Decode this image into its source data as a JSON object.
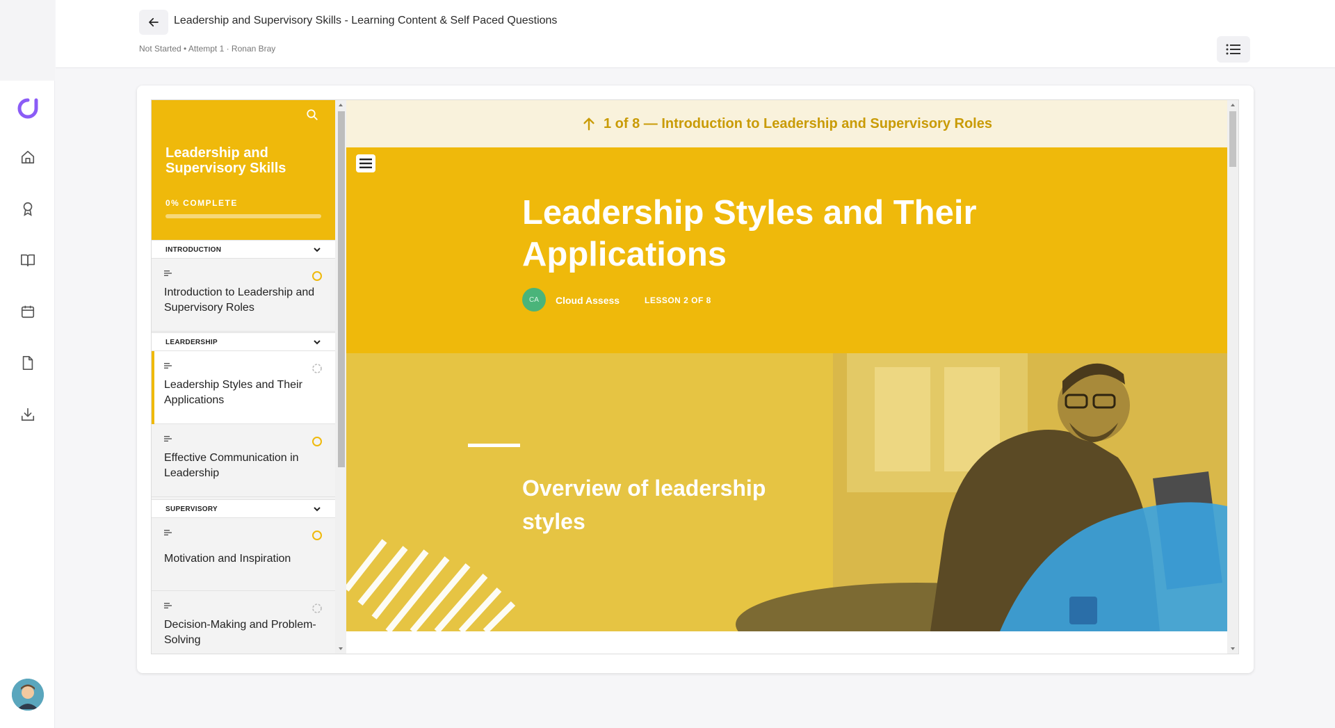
{
  "header": {
    "title": "Leadership and Supervisory Skills - Learning Content & Self Paced Questions",
    "subtitle": "Not Started • Attempt 1 · Ronan Bray"
  },
  "rail": {
    "icons": [
      "logo-icon",
      "home-icon",
      "award-icon",
      "book-icon",
      "calendar-icon",
      "document-icon",
      "download-icon"
    ]
  },
  "sidebar": {
    "course_title": "Leadership and Supervisory Skills",
    "progress_label": "0% COMPLETE",
    "progress_percent": 0,
    "sections": [
      {
        "label": "INTRODUCTION"
      },
      {
        "label": "LEARDERSHIP"
      },
      {
        "label": "SUPERVISORY"
      }
    ],
    "lessons": [
      {
        "label": "Introduction to Leadership and Supervisory Roles"
      },
      {
        "label": "Leadership Styles and Their Applications"
      },
      {
        "label": "Effective Communication in Leadership"
      },
      {
        "label": "Motivation and Inspiration"
      },
      {
        "label": "Decision-Making and Problem-Solving"
      }
    ]
  },
  "content": {
    "prev_lesson": "1 of 8 — Introduction to Leadership and Supervisory Roles",
    "lesson_title": "Leadership Styles and Their Applications",
    "author_initials": "CA",
    "author_name": "Cloud Assess",
    "lesson_count": "LESSON 2 OF 8",
    "banner_heading": "Overview of leadership styles"
  },
  "colors": {
    "accent": "#efb90b",
    "prev_bar_bg": "#f9f2dc",
    "prev_bar_text": "#c99b06",
    "logo": "#8b5cf6",
    "author_badge": "#4ab47a",
    "banner_blue": "#3aa3e0"
  }
}
